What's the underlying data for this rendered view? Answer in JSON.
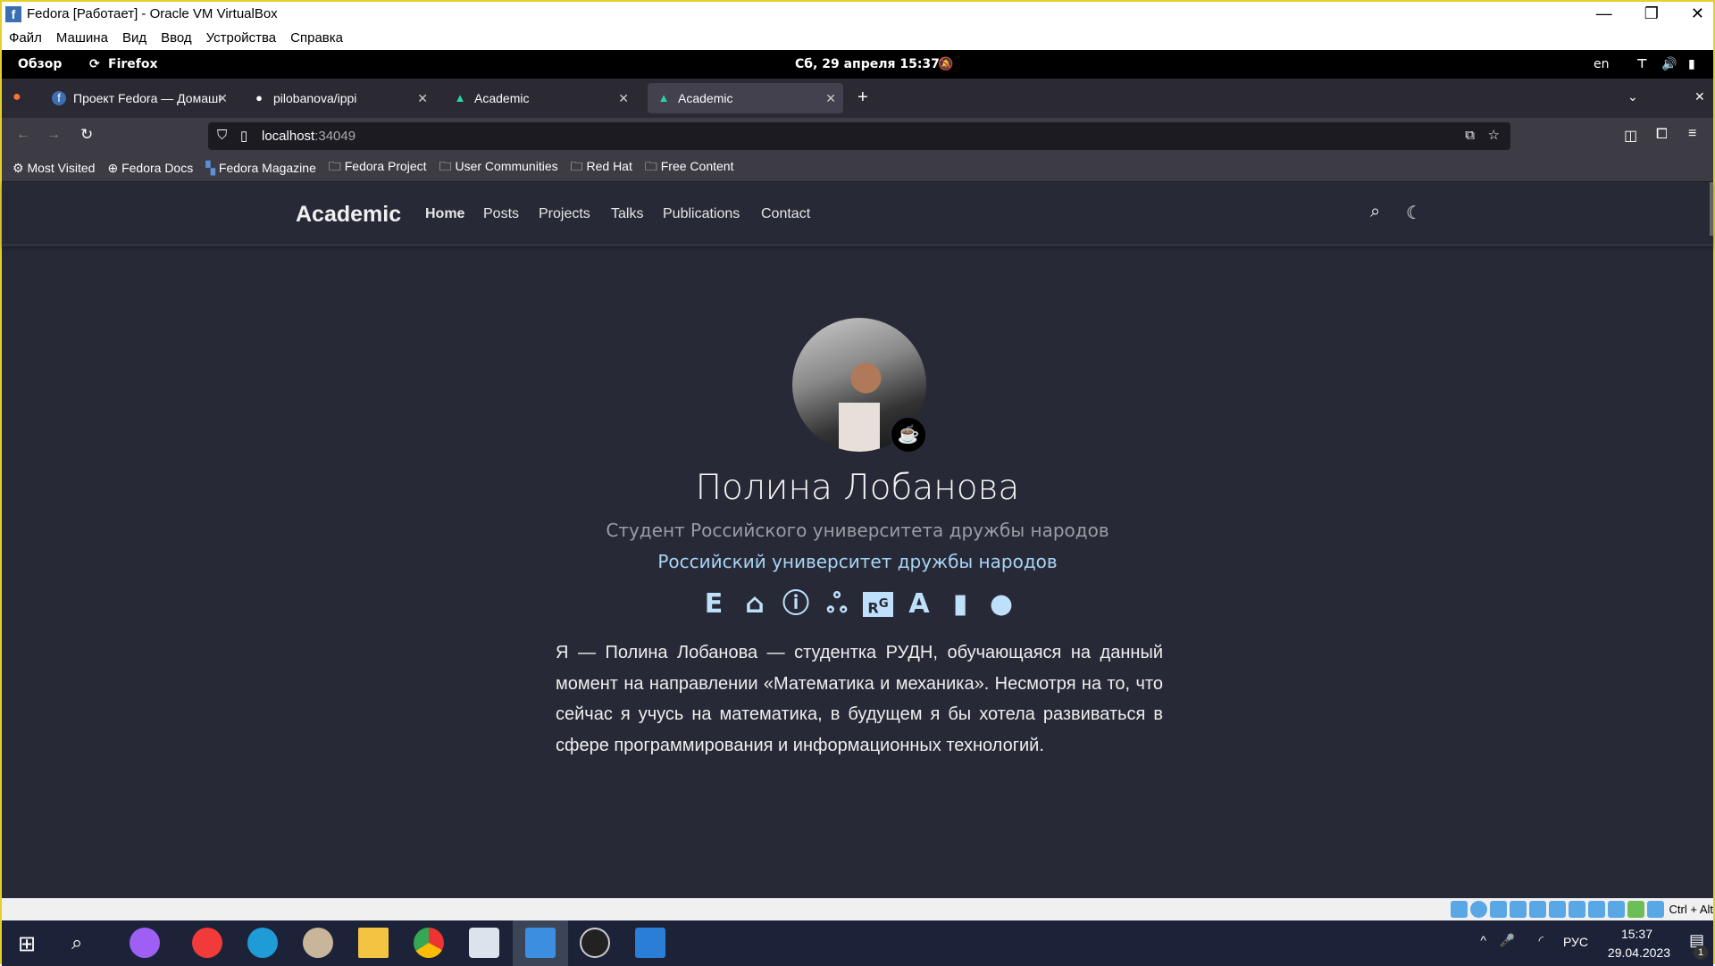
{
  "window": {
    "title": "Fedora [Работает] - Oracle VM VirtualBox",
    "minimize": "—",
    "restore": "❐",
    "close": "✕"
  },
  "menu": [
    "Файл",
    "Машина",
    "Вид",
    "Ввод",
    "Устройства",
    "Справка"
  ],
  "gnome": {
    "overview": "Обзор",
    "app": "Firefox",
    "datetime": "Сб, 29 апреля  15:37",
    "lang": "en"
  },
  "tabs": [
    {
      "label": "Проект Fedora — Домашняя",
      "icon": "fedora-icon"
    },
    {
      "label": "pilobanova/ippi",
      "icon": "github-icon"
    },
    {
      "label": "Academic",
      "icon": "academic-icon"
    },
    {
      "label": "Academic",
      "icon": "academic-icon",
      "active": true
    }
  ],
  "url": {
    "host": "localhost",
    "port": ":34049"
  },
  "bookmarks": [
    "Most Visited",
    "Fedora Docs",
    "Fedora Magazine",
    "Fedora Project",
    "User Communities",
    "Red Hat",
    "Free Content"
  ],
  "site": {
    "brand": "Academic",
    "nav": [
      "Home",
      "Posts",
      "Projects",
      "Talks",
      "Publications",
      "Contact"
    ]
  },
  "profile": {
    "name": "Полина Лобанова",
    "role": "Студент Российского университета дружбы народов",
    "organization": "Российский университет дружбы народов",
    "bio": "Я — Полина Лобанова — студентка РУДН, обучающаяся на данный момент на направлении «Математика и механика». Несмотря на то, что сейчас я учусь на математика, в будущем я бы хотела развиваться в сфере программирования и информационных технологий.",
    "social_icons": [
      "email-icon",
      "google-scholar-icon",
      "orcid-icon",
      "mendeley-icon",
      "researchgate-icon",
      "academia-icon",
      "cv-icon",
      "github-icon"
    ]
  },
  "statusbar": {
    "hostkey": "Ctrl + Alt"
  },
  "taskbar": {
    "time": "15:37",
    "date": "29.04.2023",
    "lang": "РУС",
    "notifications": "1"
  },
  "colors": {
    "page_bg": "#272a36",
    "accent": "#a8d4f5"
  }
}
